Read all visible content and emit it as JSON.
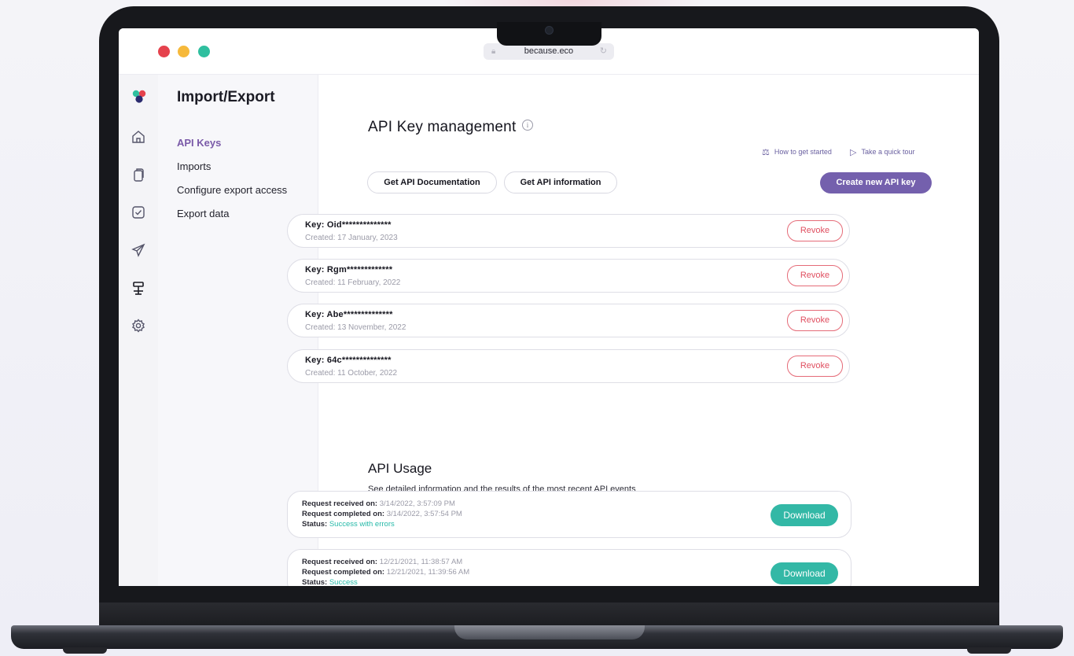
{
  "browser": {
    "url": "because.eco",
    "traffic_lights": [
      "#e5424d",
      "#f6b93b",
      "#2fbf9f"
    ]
  },
  "rail": {
    "items": [
      "home-icon",
      "documents-icon",
      "checkbox-icon",
      "send-icon",
      "import-export-icon",
      "settings-icon"
    ],
    "active": "import-export-icon"
  },
  "subnav": {
    "title": "Import/Export",
    "items": [
      {
        "label": "API Keys",
        "active": true
      },
      {
        "label": "Imports",
        "active": false
      },
      {
        "label": "Configure export access",
        "active": false
      },
      {
        "label": "Export data",
        "active": false
      }
    ]
  },
  "main": {
    "title": "API Key management",
    "info_icon": "info-icon",
    "links": {
      "how_to_start": "How to get started",
      "quick_tour": "Take a quick tour"
    },
    "buttons": {
      "api_docs": "Get API Documentation",
      "api_info": "Get API information",
      "create": "Create new API key"
    },
    "keys": [
      {
        "label": "Key: Oid**************",
        "created": "Created: 17 January, 2023",
        "action": "Revoke"
      },
      {
        "label": "Key: Rgm*************",
        "created": "Created: 11 February, 2022",
        "action": "Revoke"
      },
      {
        "label": "Key: Abe**************",
        "created": "Created: 13 November, 2022",
        "action": "Revoke"
      },
      {
        "label": "Key: 64c**************",
        "created": "Created: 11 October, 2022",
        "action": "Revoke"
      }
    ],
    "usage": {
      "title": "API Usage",
      "subtitle": "See detailed information and the results of the most recent API events",
      "received_label": "Request received on:",
      "completed_label": "Request completed on:",
      "status_label": "Status:",
      "events": [
        {
          "received": "3/14/2022, 3:57:09 PM",
          "completed": "3/14/2022, 3:57:54 PM",
          "status": "Success with errors",
          "action": "Download"
        },
        {
          "received": "12/21/2021, 11:38:57 AM",
          "completed": "12/21/2021, 11:39:56 AM",
          "status": "Success",
          "action": "Download"
        }
      ]
    }
  },
  "colors": {
    "accent_purple": "#7460ad",
    "revoke_red": "#e04f60",
    "download_teal": "#33b8a6",
    "status_teal": "#25b9a8"
  }
}
